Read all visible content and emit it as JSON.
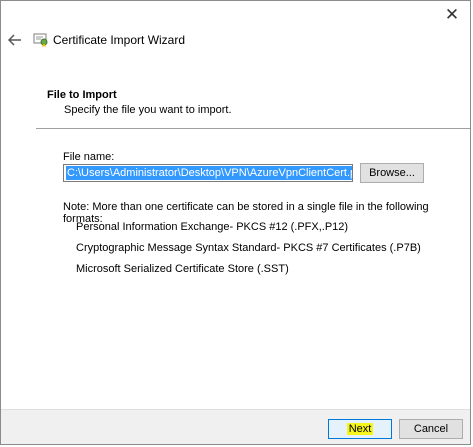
{
  "window": {
    "title": "Certificate Import Wizard",
    "close_glyph": "✕",
    "back_icon": "back-arrow-icon",
    "title_icon": "certificate-icon"
  },
  "header": {
    "section_title": "File to Import",
    "section_subtitle": "Specify the file you want to import."
  },
  "form": {
    "file_label": "File name:",
    "file_value": "C:\\Users\\Administrator\\Desktop\\VPN\\AzureVpnClientCert.pfx",
    "browse_label": "Browse..."
  },
  "note": {
    "text": "Note:  More than one certificate can be stored in a single file in the following formats:",
    "formats": [
      "Personal Information Exchange- PKCS #12 (.PFX,.P12)",
      "Cryptographic Message Syntax Standard- PKCS #7 Certificates (.P7B)",
      "Microsoft Serialized Certificate Store (.SST)"
    ]
  },
  "footer": {
    "next_label": "Next",
    "cancel_label": "Cancel",
    "highlight_color": "#f5f51a"
  }
}
